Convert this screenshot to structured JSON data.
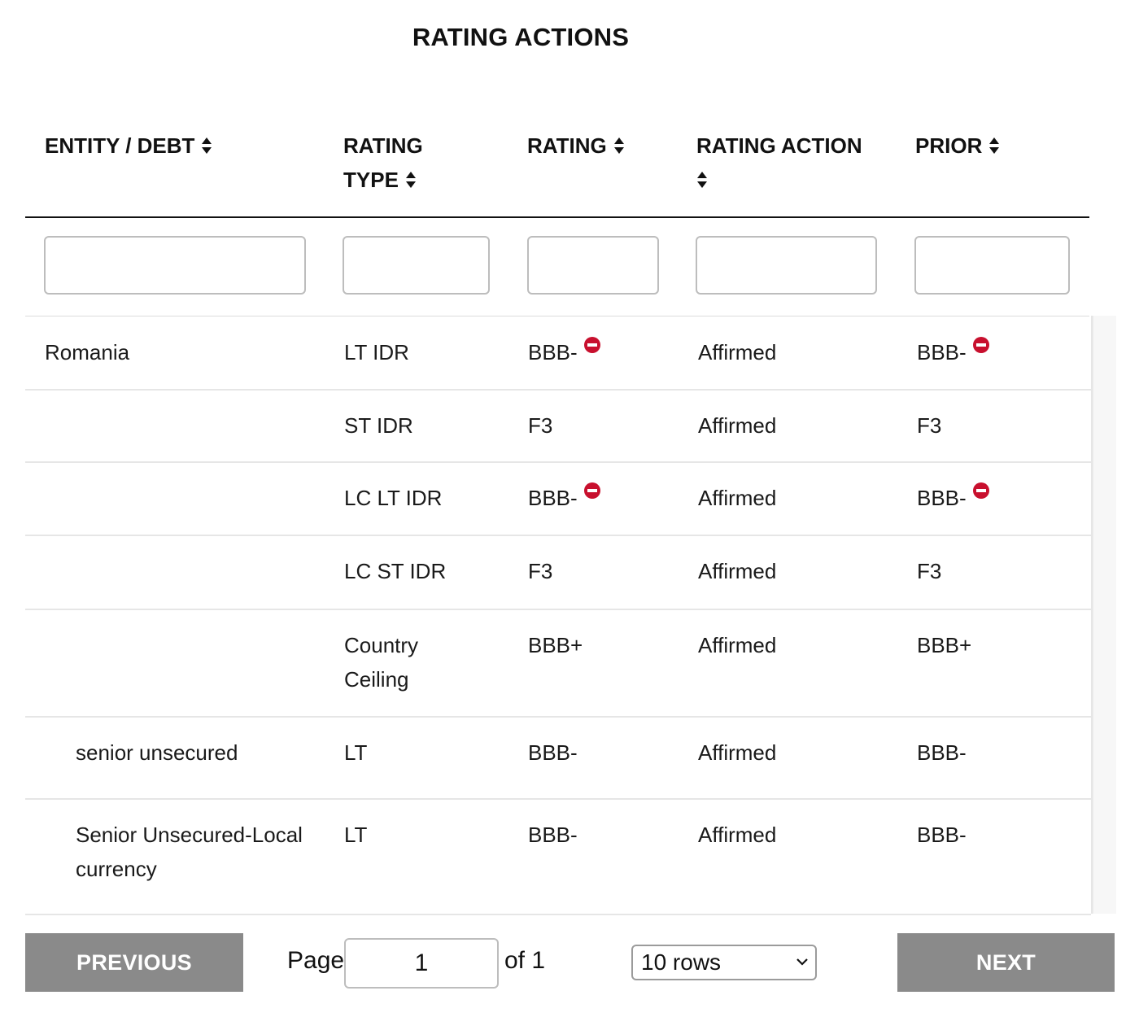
{
  "title": "RATING ACTIONS",
  "columns": [
    {
      "label_lines": [
        "ENTITY / DEBT"
      ],
      "sortable": true
    },
    {
      "label_lines": [
        "RATING",
        "TYPE"
      ],
      "sortable": true
    },
    {
      "label_lines": [
        "RATING"
      ],
      "sortable": true
    },
    {
      "label_lines": [
        "RATING ACTION"
      ],
      "sortable": true
    },
    {
      "label_lines": [
        "PRIOR"
      ],
      "sortable": true
    }
  ],
  "filters": [
    "",
    "",
    "",
    "",
    ""
  ],
  "rows": [
    {
      "entity": "Romania",
      "indent": false,
      "type": [
        "LT IDR"
      ],
      "rating": "BBB-",
      "rating_watch": true,
      "action": "Affirmed",
      "prior": "BBB-",
      "prior_watch": true
    },
    {
      "entity": "",
      "indent": false,
      "type": [
        "ST IDR"
      ],
      "rating": "F3",
      "rating_watch": false,
      "action": "Affirmed",
      "prior": "F3",
      "prior_watch": false
    },
    {
      "entity": "",
      "indent": false,
      "type": [
        "LC LT IDR"
      ],
      "rating": "BBB-",
      "rating_watch": true,
      "action": "Affirmed",
      "prior": "BBB-",
      "prior_watch": true
    },
    {
      "entity": "",
      "indent": false,
      "type": [
        "LC ST IDR"
      ],
      "rating": "F3",
      "rating_watch": false,
      "action": "Affirmed",
      "prior": "F3",
      "prior_watch": false
    },
    {
      "entity": "",
      "indent": false,
      "type": [
        "Country",
        "Ceiling"
      ],
      "rating": "BBB+",
      "rating_watch": false,
      "action": "Affirmed",
      "prior": "BBB+",
      "prior_watch": false
    },
    {
      "entity": "senior unsecured",
      "indent": true,
      "type": [
        "LT"
      ],
      "rating": "BBB-",
      "rating_watch": false,
      "action": "Affirmed",
      "prior": "BBB-",
      "prior_watch": false
    },
    {
      "entity": "Senior Unsecured-Local\ncurrency",
      "indent": true,
      "type": [
        "LT"
      ],
      "rating": "BBB-",
      "rating_watch": false,
      "action": "Affirmed",
      "prior": "BBB-",
      "prior_watch": false
    }
  ],
  "pagination": {
    "previous_label": "PREVIOUS",
    "page_label": "Page",
    "page_value": "1",
    "of_label": "of 1",
    "rows_option": "10 rows",
    "next_label": "NEXT"
  },
  "colors": {
    "watch_negative": "#c8102e",
    "button_bg": "#8a8a8a"
  },
  "icons": {
    "sort": "sort-updown-icon",
    "watch": "rating-watch-negative-icon",
    "chevron": "chevron-down-icon"
  }
}
